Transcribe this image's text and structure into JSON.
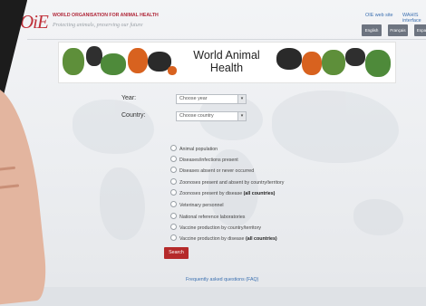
{
  "header": {
    "logo": "OiE",
    "org_name": "WORLD ORGANISATION FOR ANIMAL HEALTH",
    "tagline": "Protecting animals, preserving our future",
    "links": [
      "OIE web site",
      "WAHIS interface"
    ],
    "languages": [
      "English",
      "Français",
      "Español"
    ]
  },
  "banner": {
    "title_line1": "World Animal",
    "title_line2": "Health"
  },
  "form": {
    "year_label": "Year:",
    "year_value": "Choose year",
    "country_label": "Country:",
    "country_value": "Choose country",
    "options": [
      {
        "text": "Animal population",
        "suffix": ""
      },
      {
        "text": "Diseases/infections present",
        "suffix": ""
      },
      {
        "text": "Diseases absent or never occurred",
        "suffix": ""
      },
      {
        "text": "Zoonoses present and absent by country/territory",
        "suffix": ""
      },
      {
        "text": "Zoonoses present by disease ",
        "suffix": "(all countries)"
      },
      {
        "text": "Veterinary personnel",
        "suffix": ""
      },
      {
        "text": "National reference laboratories",
        "suffix": ""
      },
      {
        "text": "Vaccine production by country/territory",
        "suffix": ""
      },
      {
        "text": "Vaccine production by disease ",
        "suffix": "(all countries)"
      }
    ],
    "search_label": "Search"
  },
  "footer": {
    "faq": "Frequently asked questions (FAQ)"
  },
  "colors": {
    "brand_red": "#b52a2a",
    "link_blue": "#3a6fb0"
  }
}
